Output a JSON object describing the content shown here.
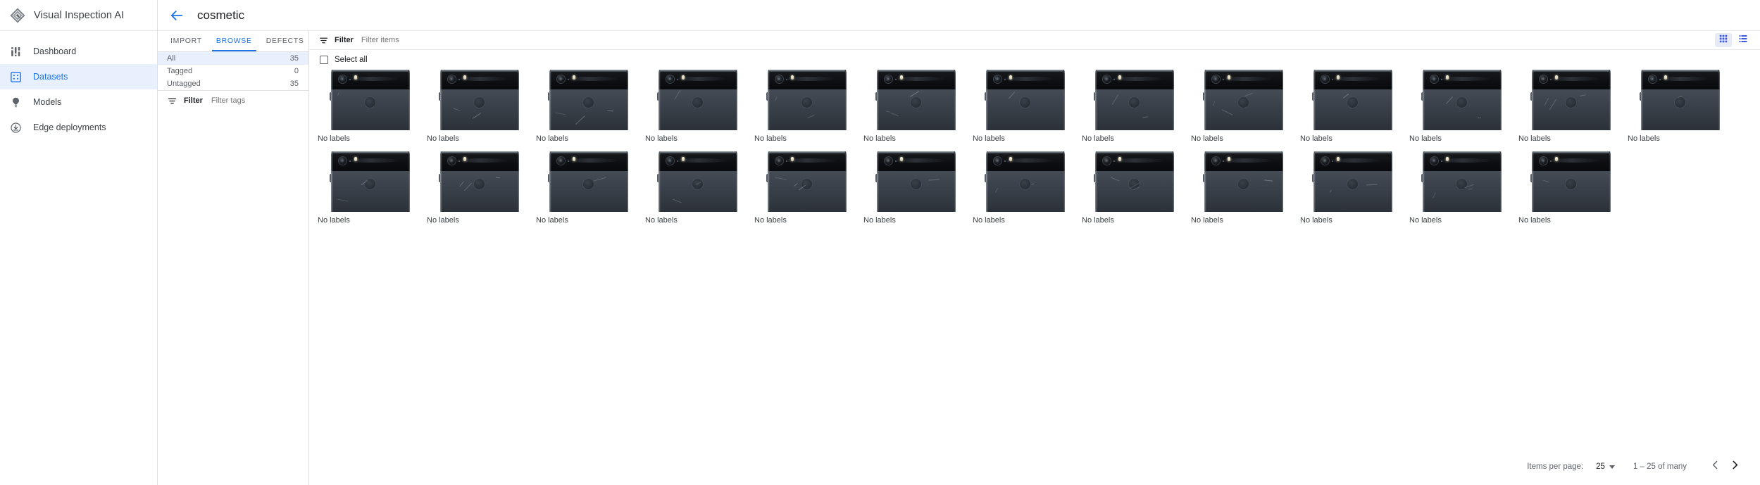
{
  "brand": {
    "title": "Visual Inspection AI",
    "logo_icon": "inspection-diamond-lens-icon"
  },
  "sidebar": {
    "items": [
      {
        "label": "Dashboard",
        "icon": "dashboard-icon",
        "active": false
      },
      {
        "label": "Datasets",
        "icon": "datasets-grid-icon",
        "active": true
      },
      {
        "label": "Models",
        "icon": "lightbulb-icon",
        "active": false
      },
      {
        "label": "Edge deployments",
        "icon": "download-circle-icon",
        "active": false
      }
    ]
  },
  "topbar": {
    "back_icon": "arrow-back-icon",
    "title": "cosmetic"
  },
  "tabs": [
    {
      "label": "IMPORT",
      "active": false
    },
    {
      "label": "BROWSE",
      "active": true
    },
    {
      "label": "DEFECTS",
      "active": false
    }
  ],
  "panel": {
    "filters": [
      {
        "label": "All",
        "count": "35",
        "active": true
      },
      {
        "label": "Tagged",
        "count": "0",
        "active": false
      },
      {
        "label": "Untagged",
        "count": "35",
        "active": false
      }
    ],
    "tag_filter": {
      "icon": "filter-icon",
      "label": "Filter",
      "placeholder": "Filter tags",
      "value": ""
    }
  },
  "toolbar": {
    "filter_icon": "filter-icon",
    "filter_label": "Filter",
    "filter_placeholder": "Filter items",
    "filter_value": "",
    "grid_view_icon": "grid-view-icon",
    "list_view_icon": "list-view-icon",
    "grid_view_active": true
  },
  "select_all": {
    "label": "Select all",
    "checked": false,
    "checkbox_icon": "checkbox-unchecked-icon"
  },
  "grid": {
    "item_label": "No labels",
    "rows": [
      {
        "count": 13
      },
      {
        "count": 12
      }
    ]
  },
  "footer": {
    "items_per_page_label": "Items per page:",
    "items_per_page_value": "25",
    "caret_icon": "chevron-down-icon",
    "range_text": "1 – 25 of many",
    "prev_icon": "chevron-left-icon",
    "next_icon": "chevron-right-icon"
  },
  "colors": {
    "accent": "#1a73e8",
    "accent_bg": "#e8f0fe",
    "text": "#3c4043",
    "muted": "#5f6368",
    "border": "#e0e0e0"
  }
}
